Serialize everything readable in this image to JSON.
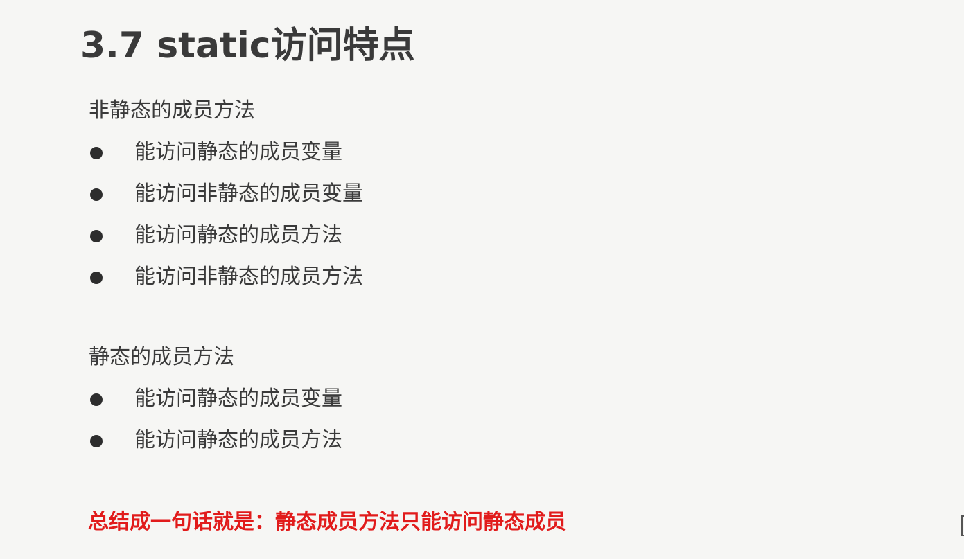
{
  "title": "3.7 static访问特点",
  "non_static": {
    "heading": "非静态的成员方法",
    "items": [
      "能访问静态的成员变量",
      "能访问非静态的成员变量",
      "能访问静态的成员方法",
      "能访问非静态的成员方法"
    ]
  },
  "static": {
    "heading": "静态的成员方法",
    "items": [
      "能访问静态的成员变量",
      "能访问静态的成员方法"
    ]
  },
  "summary": "总结成一句话就是：静态成员方法只能访问静态成员",
  "colors": {
    "summary": "#e11b1b",
    "text": "#3a3a3a",
    "background": "#f6f6f4"
  }
}
